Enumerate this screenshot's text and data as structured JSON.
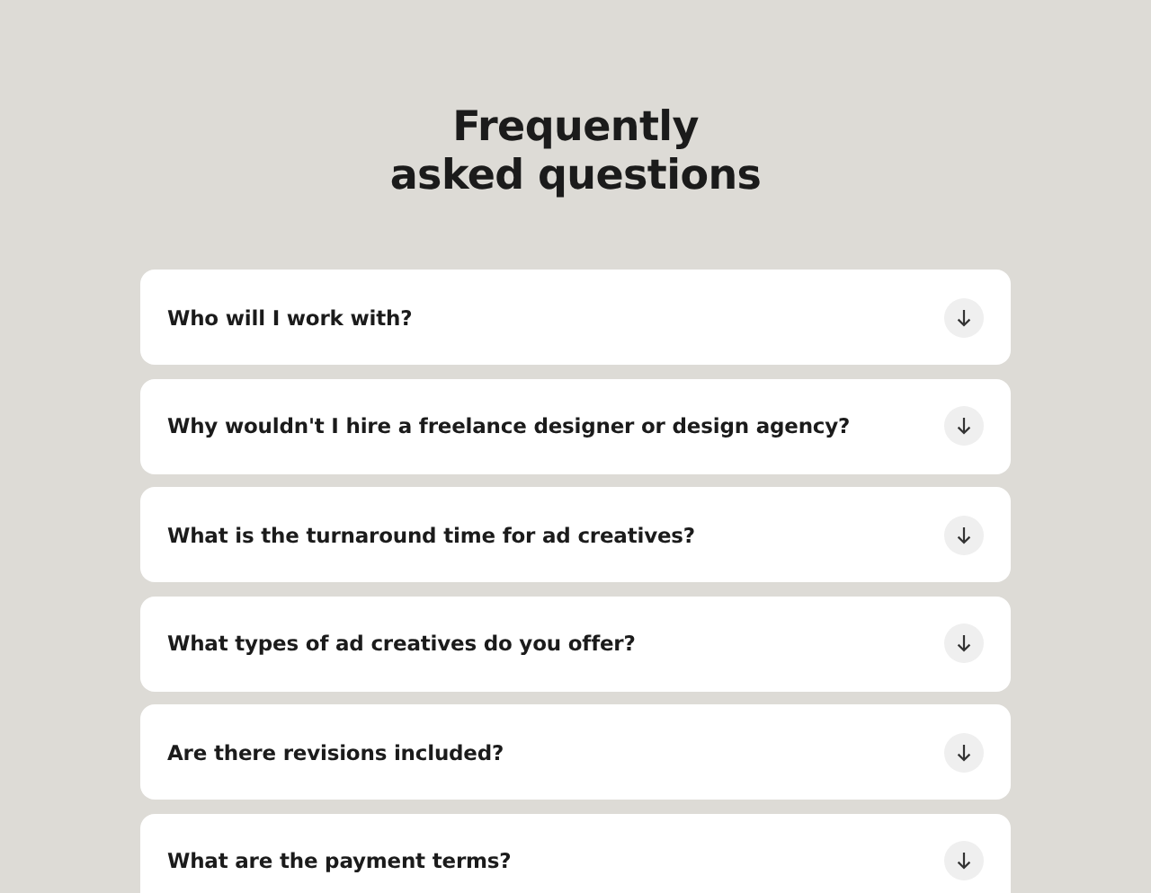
{
  "title_lines": [
    "Frequently",
    "asked questions"
  ],
  "faqs": [
    {
      "question": "Who will I work with?",
      "expanded": false
    },
    {
      "question": "Why wouldn't I hire a freelance designer or design agency?",
      "expanded": false
    },
    {
      "question": "What is the turnaround time for ad creatives?",
      "expanded": false
    },
    {
      "question": "What types of ad creatives do you offer?",
      "expanded": false
    },
    {
      "question": "Are there revisions included?",
      "expanded": false
    },
    {
      "question": "What are the payment terms?",
      "expanded": false
    }
  ]
}
